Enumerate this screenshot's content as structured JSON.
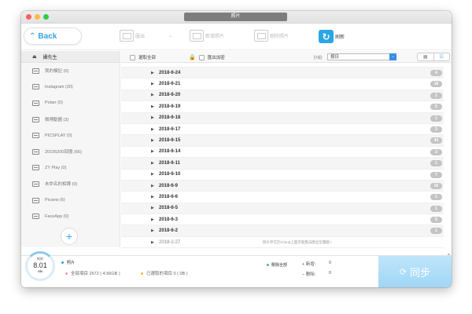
{
  "window": {
    "title": "照片",
    "traffic_lights": [
      "#fc605c",
      "#fdbc40",
      "#34c84a"
    ]
  },
  "toolbar": {
    "back_label": "Back",
    "export_label": "匯出",
    "new_photo_label": "新增照片",
    "delete_photo_label": "刪除照片",
    "refresh_label": "刷新"
  },
  "sidebar": {
    "header": "攝先生",
    "items": [
      {
        "label": "我的模記 (0)"
      },
      {
        "label": "Instagram (20)"
      },
      {
        "label": "Polarr (0)"
      },
      {
        "label": "微博動圖 (3)"
      },
      {
        "label": "PICSPLAY (0)"
      },
      {
        "label": "20195200回憶 (66)"
      },
      {
        "label": "ZY Play (0)"
      },
      {
        "label": "未命名的相簿 (0)"
      },
      {
        "label": "Picsew (6)"
      },
      {
        "label": "FaceApp (0)"
      }
    ],
    "add_symbol": "+"
  },
  "list_header": {
    "select_all": "選取全部",
    "export_encrypted": "匯出加密",
    "group_label": "分組:",
    "group_value": "按日",
    "arrow": "⌄"
  },
  "rows": [
    {
      "date": "2018-6-24",
      "count": "4"
    },
    {
      "date": "2018-6-21",
      "count": "16"
    },
    {
      "date": "2018-6-20",
      "count": "1"
    },
    {
      "date": "2018-6-19",
      "count": "5"
    },
    {
      "date": "2018-6-18",
      "count": "1"
    },
    {
      "date": "2018-6-17",
      "count": "3"
    },
    {
      "date": "2018-6-15",
      "count": "43"
    },
    {
      "date": "2018-6-14",
      "count": "3"
    },
    {
      "date": "2018-6-11",
      "count": "1"
    },
    {
      "date": "2018-6-10",
      "count": "7"
    },
    {
      "date": "2018-6-9",
      "count": "20"
    },
    {
      "date": "2018-6-6",
      "count": "1"
    },
    {
      "date": "2018-6-5",
      "count": "1"
    },
    {
      "date": "2018-6-3",
      "count": "5"
    },
    {
      "date": "2018-6-2",
      "count": "1"
    }
  ],
  "last_row": {
    "date": "2018-2-27",
    "info": "照片存在於iCloud上面可能無法匯出至電腦 •"
  },
  "footer": {
    "storage_label": "剩餘",
    "storage_value": "8.01",
    "storage_unit": "GB",
    "photos_label": "照片",
    "all_items": "全部項目 2672 ( 4.56GB )",
    "selected_items": "已選取的項目 0 ( 0B )",
    "delete_all": "刪除全部",
    "add_label": "+ 新增:",
    "delete_label": "− 刪除:",
    "add_count": "0",
    "delete_count": "0",
    "sync_label": "同步"
  },
  "colors": {
    "accent": "#2aa5e6",
    "sync_button": "#a8daf6",
    "badge": "#c4c4c4"
  }
}
